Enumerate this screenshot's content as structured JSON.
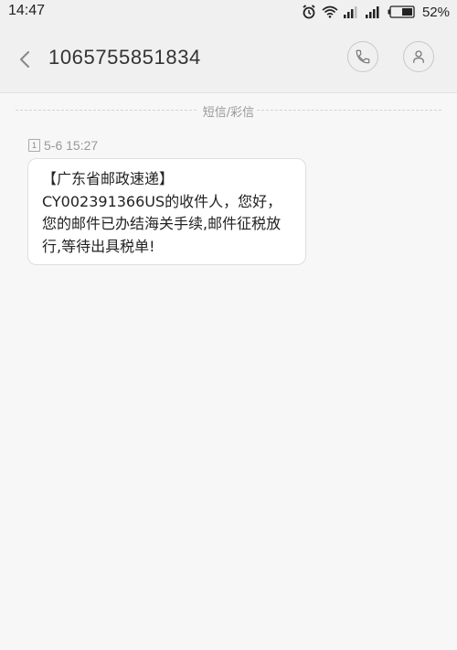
{
  "status_bar": {
    "time": "14:47",
    "battery": "52%",
    "icons": [
      "alarm-icon",
      "wifi-icon",
      "signal-icon",
      "signal-icon",
      "battery-icon"
    ]
  },
  "header": {
    "contact": "1065755851834",
    "icons": {
      "back": "chevron-left-icon",
      "call": "phone-icon",
      "contact": "person-icon"
    }
  },
  "thread": {
    "divider_label": "短信/彩信",
    "messages": [
      {
        "sim": "1",
        "timestamp": "5-6 15:27",
        "text": "【广东省邮政速递】\nCY002391366US的收件人，您好，您的邮件已办结海关手续,邮件征税放行,等待出具税单!"
      }
    ]
  },
  "colors": {
    "background": "#f7f7f7",
    "header": "#f0f0f0",
    "bubble": "#ffffff"
  }
}
